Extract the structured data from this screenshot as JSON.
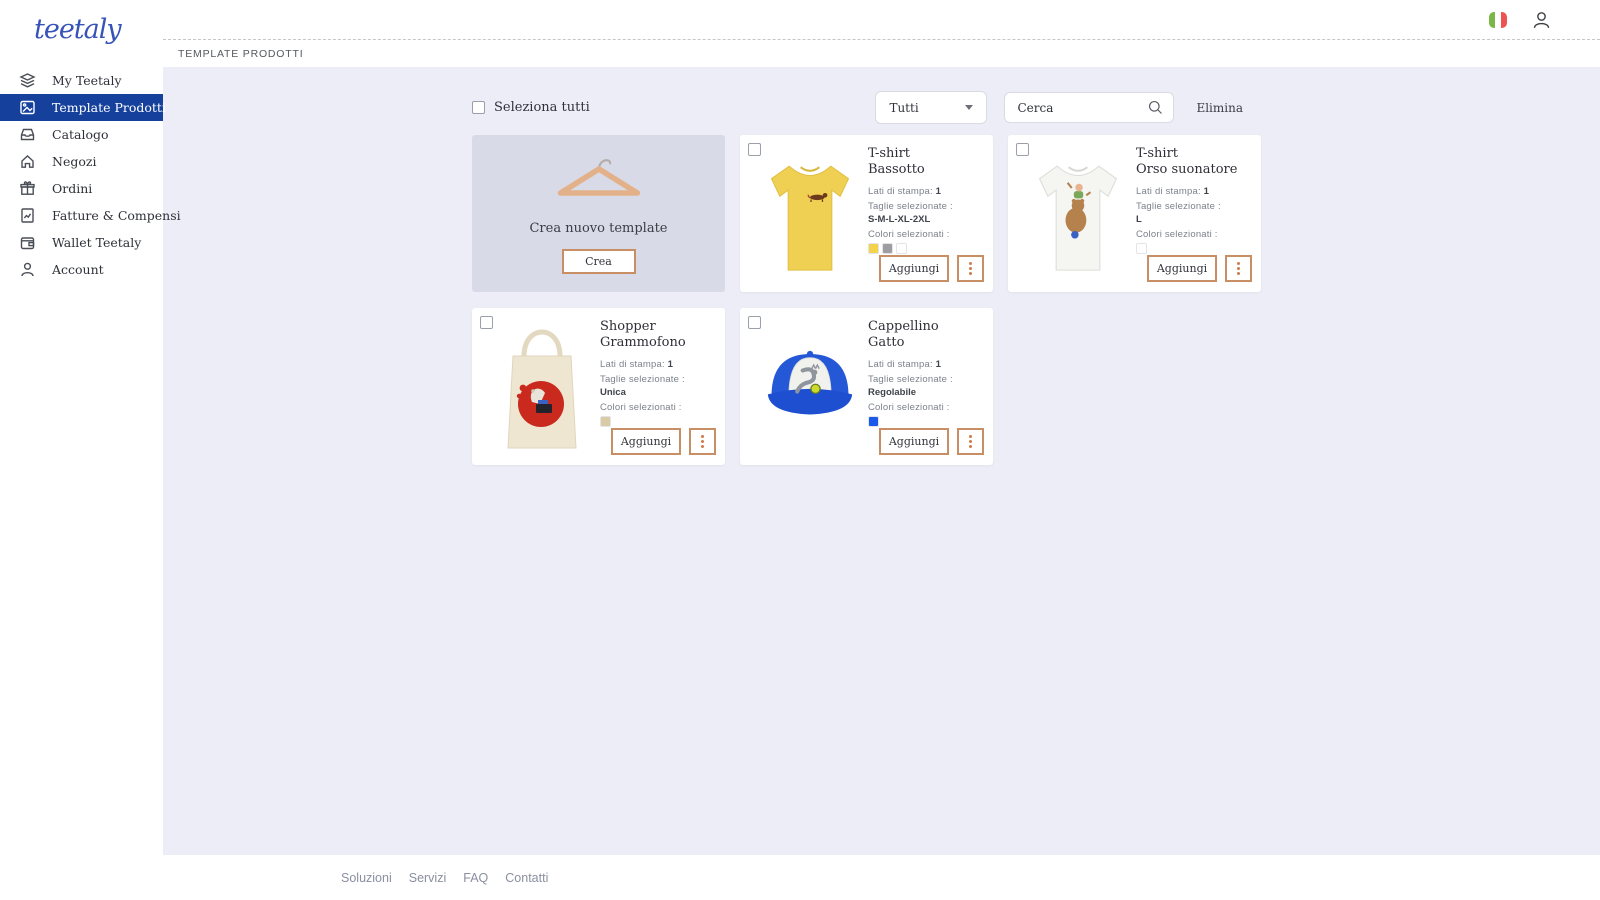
{
  "brand": {
    "logo_text": "teetaly"
  },
  "header": {
    "breadcrumb": "TEMPLATE PRODOTTI"
  },
  "sidebar": {
    "items": [
      {
        "label": "My Teetaly"
      },
      {
        "label": "Template Prodotti"
      },
      {
        "label": "Catalogo"
      },
      {
        "label": "Negozi"
      },
      {
        "label": "Ordini"
      },
      {
        "label": "Fatture & Compensi"
      },
      {
        "label": "Wallet Teetaly"
      },
      {
        "label": "Account"
      }
    ]
  },
  "toolbar": {
    "select_all_label": "Seleziona tutti",
    "filter_selected": "Tutti",
    "search_placeholder": "Cerca",
    "delete_label": "Elimina"
  },
  "labels": {
    "print_sides": "Lati di stampa:",
    "sizes": "Taglie selezionate :",
    "colors": "Colori selezionati :",
    "add_button": "Aggiungi"
  },
  "create_card": {
    "title": "Crea nuovo template",
    "button_label": "Crea"
  },
  "products": [
    {
      "name_line1": "T-shirt",
      "name_line2": "Bassotto",
      "print_sides": "1",
      "sizes": "S-M-L-XL-2XL",
      "swatches": [
        "#f2d34b",
        "#9e9ea2",
        "#ffffff"
      ]
    },
    {
      "name_line1": "T-shirt",
      "name_line2": "Orso suonatore",
      "print_sides": "1",
      "sizes": "L",
      "swatches": [
        "#ffffff"
      ]
    },
    {
      "name_line1": "Shopper",
      "name_line2": "Grammofono",
      "print_sides": "1",
      "sizes": "Unica",
      "swatches": [
        "#d8cba6"
      ]
    },
    {
      "name_line1": "Cappellino",
      "name_line2": "Gatto",
      "print_sides": "1",
      "sizes": "Regolabile",
      "swatches": [
        "#1b59e8"
      ]
    }
  ],
  "footer": {
    "links": [
      "Soluzioni",
      "Servizi",
      "FAQ",
      "Contatti"
    ]
  },
  "colors": {
    "accent_orange": "#c78f63",
    "active_nav": "#15409c",
    "logo_blue": "#3753b8",
    "main_bg": "#ecedf6"
  }
}
